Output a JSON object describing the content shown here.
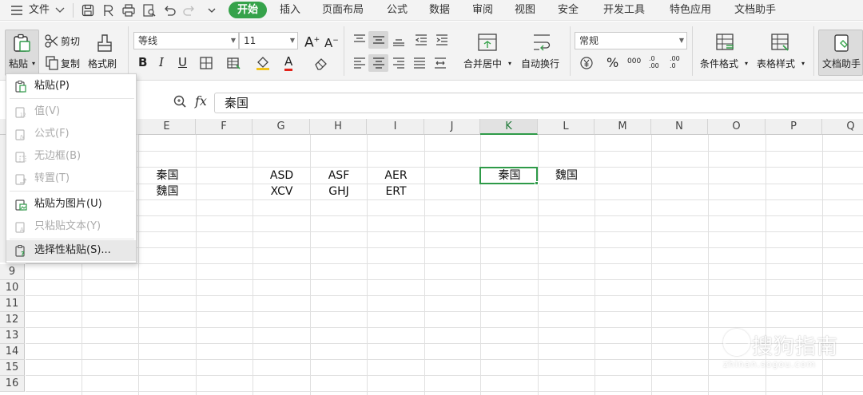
{
  "menubar": {
    "file_menu": "文件",
    "tabs": [
      "开始",
      "插入",
      "页面布局",
      "公式",
      "数据",
      "审阅",
      "视图",
      "安全",
      "开发工具",
      "特色应用",
      "文档助手"
    ],
    "active_tab": "开始"
  },
  "ribbon": {
    "paste_label": "粘贴",
    "cut_label": "剪切",
    "copy_label": "复制",
    "format_painter_label": "格式刷",
    "font_name": "等线",
    "font_size": "11",
    "number_format": "常规",
    "merge_center_label": "合并居中",
    "wrap_text_label": "自动换行",
    "conditional_format_label": "条件格式",
    "table_style_label": "表格样式",
    "doc_assistant_label": "文档助手",
    "bold_label": "B",
    "italic_label": "I",
    "underline_label": "U",
    "grow_font_label": "A",
    "shrink_font_label": "A",
    "font_color_label": "A",
    "percent_label": "%",
    "thousands_label": "000",
    "inc_decimal_label": ".0 .00",
    "dec_decimal_label": ".00 .0"
  },
  "formula_bar": {
    "fx_label": "fx",
    "value": "秦国"
  },
  "grid": {
    "columns": [
      "E",
      "F",
      "G",
      "H",
      "I",
      "J",
      "K",
      "L",
      "M",
      "N",
      "O",
      "P",
      "Q"
    ],
    "active_column": "K",
    "visible_rows": [
      "9",
      "10",
      "11",
      "12",
      "13",
      "14",
      "15",
      "16"
    ],
    "cells": {
      "E3": "秦国",
      "E4": "魏国",
      "G3": "ASD",
      "G4": "XCV",
      "H3": "ASF",
      "H4": "GHJ",
      "I3": "AER",
      "I4": "ERT",
      "K3": "秦国",
      "L3": "魏国"
    }
  },
  "paste_menu": {
    "items": [
      {
        "label": "粘贴(P)",
        "enabled": true
      },
      {
        "label": "值(V)",
        "enabled": false
      },
      {
        "label": "公式(F)",
        "enabled": false
      },
      {
        "label": "无边框(B)",
        "enabled": false
      },
      {
        "label": "转置(T)",
        "enabled": false
      },
      {
        "label": "粘贴为图片(U)",
        "enabled": true
      },
      {
        "label": "只粘贴文本(Y)",
        "enabled": false
      },
      {
        "label": "选择性粘贴(S)...",
        "enabled": true
      }
    ],
    "highlighted": "选择性粘贴(S)..."
  },
  "watermark": {
    "text": "搜狗指南",
    "subtext": "zhinan.sogou.com"
  },
  "colors": {
    "accent_green": "#35a24a",
    "selection_border": "#2e9a48",
    "toolbar_bg": "#f3f3f3",
    "disabled_text": "#ababab"
  }
}
